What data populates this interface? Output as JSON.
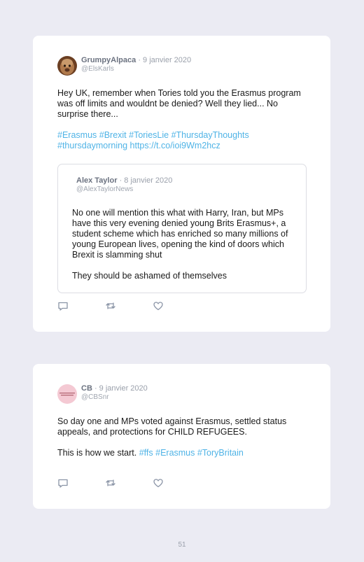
{
  "tweets": [
    {
      "author_name": "GrumpyAlpaca",
      "date": "· 9 janvier 2020",
      "handle": "@ElsKarls",
      "paragraphs": [
        "Hey UK, remember when Tories told you the Erasmus program was off limits and wouldnt be denied? Well they lied... No surprise there..."
      ],
      "tags_line_1": "#Erasmus #Brexit #ToriesLie #ThursdayThoughts",
      "tags_line_2": "#thursdaymorning https://t.co/ioi9Wm2hcz",
      "quoted": {
        "author_name": "Alex Taylor",
        "date": "· 8 janvier 2020",
        "handle": "@AlexTaylorNews",
        "paragraphs": [
          "No one will mention this what with Harry, Iran, but MPs have this very evening denied young Brits Erasmus+, a student scheme which has enriched so many millions of young European lives, opening the kind of doors which Brexit is slamming shut",
          "They should be ashamed of themselves"
        ]
      }
    },
    {
      "author_name": "CB",
      "date": "· 9 janvier 2020",
      "handle": "@CBSnr",
      "avatar_text": "the world of ours | the shape of ours",
      "paragraphs": [
        "So day one and MPs voted against Erasmus, settled status appeals, and protections for CHILD REFUGEES."
      ],
      "last_line_text": "This is how we start.",
      "last_line_tags": "#ffs #Erasmus #ToryBritain"
    }
  ],
  "icons": {
    "reply": "reply-icon",
    "retweet": "retweet-icon",
    "like": "heart-icon"
  },
  "colors": {
    "background": "#ebebf3",
    "card": "#ffffff",
    "hashtag": "#4fb3e6",
    "icon": "#8a94a6"
  },
  "page_number": "51"
}
